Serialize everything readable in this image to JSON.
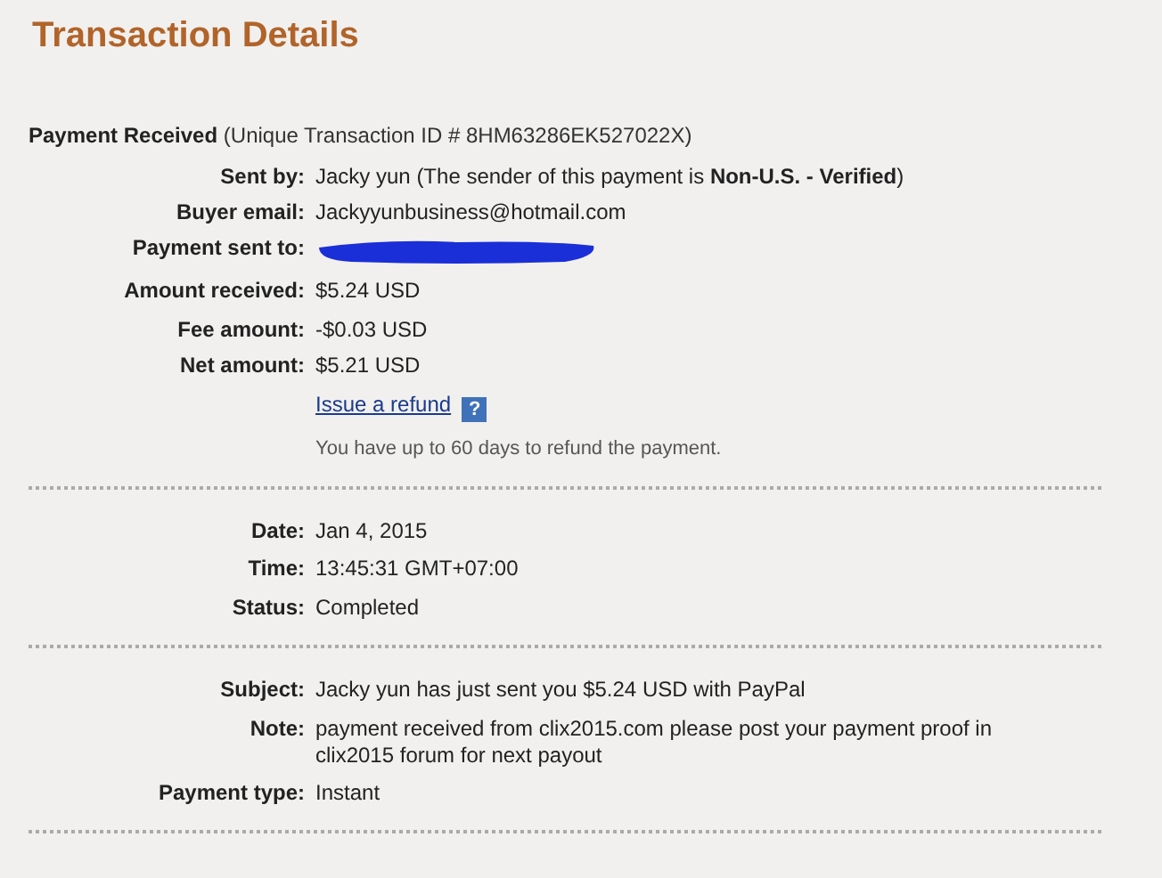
{
  "title": "Transaction Details",
  "summary": {
    "heading": "Payment Received",
    "detail": "(Unique Transaction ID # 8HM63286EK527022X)"
  },
  "sections": [
    {
      "groups": [
        [
          {
            "kind": "text",
            "label": "Sent by:",
            "value": "Jacky yun (The sender of this payment is **Non-U.S. - Verified**)"
          },
          {
            "kind": "text",
            "label": "Buyer email:",
            "value": "Jackyyunbusiness@hotmail.com"
          },
          {
            "kind": "redacted",
            "label": "Payment sent to:"
          }
        ],
        [
          {
            "kind": "text",
            "label": "Amount received:",
            "value": "$5.24 USD"
          }
        ],
        [
          {
            "kind": "text",
            "label": "Fee amount:",
            "value": "-$0.03 USD"
          },
          {
            "kind": "text",
            "label": "Net amount:",
            "value": "$5.21 USD"
          }
        ],
        [
          {
            "kind": "link",
            "value": "Issue a refund",
            "help": "?"
          }
        ],
        [
          {
            "kind": "hint",
            "value": "You have up to 60 days to refund the payment."
          }
        ]
      ]
    },
    {
      "groups": [
        [
          {
            "kind": "text",
            "label": "Date:",
            "value": "Jan 4, 2015"
          },
          {
            "kind": "text",
            "label": "Time:",
            "value": "13:45:31 GMT+07:00"
          }
        ],
        [
          {
            "kind": "text",
            "label": "Status:",
            "value": "Completed"
          }
        ]
      ]
    },
    {
      "groups": [
        [
          {
            "kind": "text",
            "label": "Subject:",
            "value": "Jacky yun has just sent you $5.24 USD with PayPal"
          }
        ],
        [
          {
            "kind": "text",
            "label": "Note:",
            "value": "payment received from clix2015.com please post your payment proof in clix2015 forum for next payout"
          },
          {
            "kind": "text",
            "label": "Payment type:",
            "value": "Instant"
          }
        ]
      ]
    }
  ]
}
